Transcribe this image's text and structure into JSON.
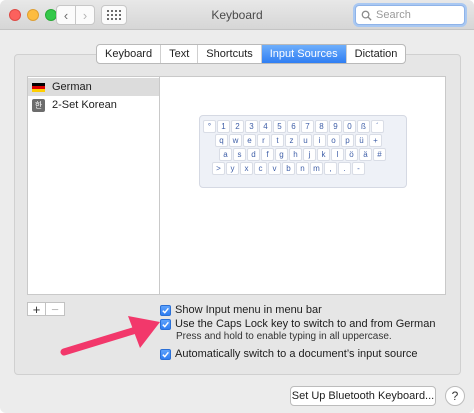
{
  "window": {
    "title": "Keyboard"
  },
  "toolbar": {
    "back_glyph": "‹",
    "forward_glyph": "›"
  },
  "search": {
    "placeholder": "Search",
    "value": ""
  },
  "tabs": [
    {
      "label": "Keyboard",
      "active": false
    },
    {
      "label": "Text",
      "active": false
    },
    {
      "label": "Shortcuts",
      "active": false
    },
    {
      "label": "Input Sources",
      "active": true
    },
    {
      "label": "Dictation",
      "active": false
    }
  ],
  "sources": [
    {
      "label": "German",
      "icon": "german-flag-icon",
      "selected": true
    },
    {
      "label": "2-Set Korean",
      "icon": "korean-input-icon",
      "selected": false
    }
  ],
  "korean_icon_glyph": "한",
  "keyboard": {
    "rows": [
      [
        "°",
        "1",
        "2",
        "3",
        "4",
        "5",
        "6",
        "7",
        "8",
        "9",
        "0",
        "ß",
        "´"
      ],
      [
        "q",
        "w",
        "e",
        "r",
        "t",
        "z",
        "u",
        "i",
        "o",
        "p",
        "ü",
        "+"
      ],
      [
        "a",
        "s",
        "d",
        "f",
        "g",
        "h",
        "j",
        "k",
        "l",
        "ö",
        "ä",
        "#"
      ],
      [
        ">",
        "y",
        "x",
        "c",
        "v",
        "b",
        "n",
        "m",
        ",",
        ".",
        "-"
      ]
    ]
  },
  "list_controls": {
    "add": "+",
    "remove": "−"
  },
  "options": {
    "show_menu": {
      "label": "Show Input menu in menu bar",
      "checked": true
    },
    "caps_lock": {
      "label": "Use the Caps Lock key to switch to and from German",
      "checked": true
    },
    "caps_hint": "Press and hold to enable typing in all uppercase.",
    "auto_switch": {
      "label": "Automatically switch to a document’s input source",
      "checked": true
    }
  },
  "bottom": {
    "bluetooth_button": "Set Up Bluetooth Keyboard...",
    "help": "?"
  },
  "colors": {
    "accent": "#2f7ef3",
    "annotation_arrow": "#f2386b"
  }
}
